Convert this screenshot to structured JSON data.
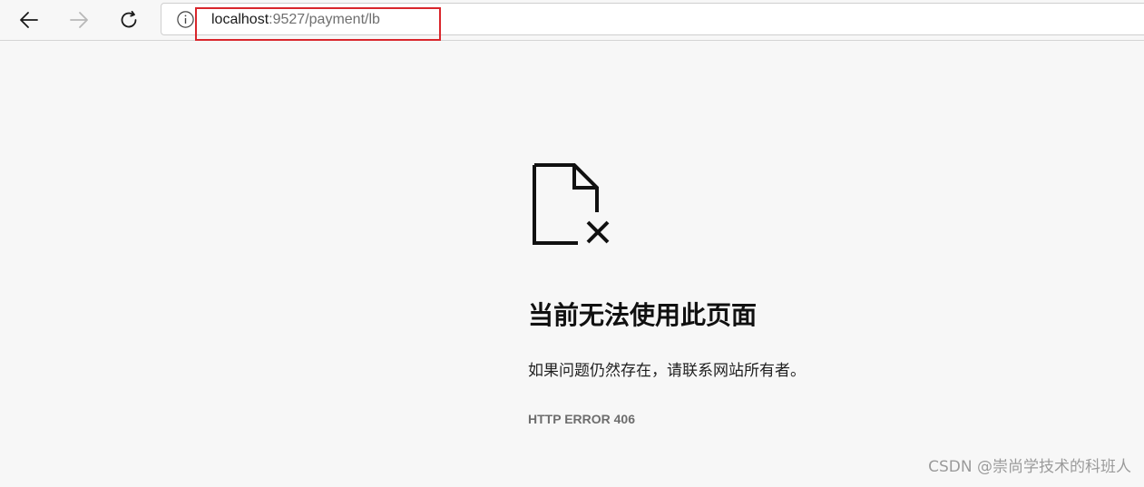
{
  "browser": {
    "address_bar": {
      "url_host": "localhost",
      "url_rest": ":9527/payment/lb"
    },
    "icons": {
      "back": "arrow-left-icon",
      "forward": "arrow-right-icon",
      "refresh": "refresh-icon",
      "site_info": "info-circle-icon"
    },
    "highlight_color": "#d9262c"
  },
  "error_page": {
    "icon": "broken-document-icon",
    "title": "当前无法使用此页面",
    "description": "如果问题仍然存在，请联系网站所有者。",
    "error_code": "HTTP ERROR 406"
  },
  "watermark": {
    "text": "CSDN @崇尚学技术的科班人"
  }
}
